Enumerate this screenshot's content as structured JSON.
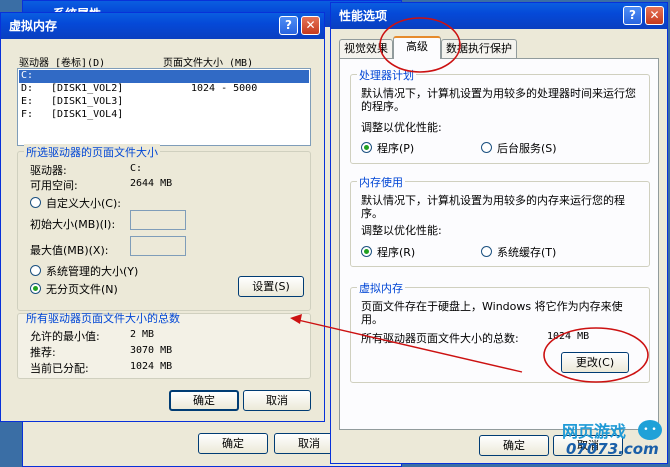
{
  "back_window": {
    "title": "系统属性",
    "ok": "确定",
    "cancel": "取消"
  },
  "virtual_memory_dialog": {
    "title": "虚拟内存",
    "help": "?",
    "close": "✕",
    "columns": {
      "drive": "驱动器 [卷标](D)",
      "size": "页面文件大小 (MB)"
    },
    "drives": [
      {
        "drive": "C:",
        "label": "",
        "size": ""
      },
      {
        "drive": "D:",
        "label": "[DISK1_VOL2]",
        "size": "1024 - 5000"
      },
      {
        "drive": "E:",
        "label": "[DISK1_VOL3]",
        "size": ""
      },
      {
        "drive": "F:",
        "label": "[DISK1_VOL4]",
        "size": ""
      }
    ],
    "selected": {
      "title": "所选驱动器的页面文件大小",
      "drive_label": "驱动器:",
      "drive_value": "C:",
      "space_label": "可用空间:",
      "space_value": "2644 MB",
      "custom_size": "自定义大小(C):",
      "initial_size": "初始大小(MB)(I):",
      "max_size": "最大值(MB)(X):",
      "system_managed": "系统管理的大小(Y)",
      "no_paging": "无分页文件(N)",
      "set_button": "设置(S)"
    },
    "totals": {
      "title": "所有驱动器页面文件大小的总数",
      "min_label": "允许的最小值:",
      "min_value": "2 MB",
      "recommended_label": "推荐:",
      "recommended_value": "3070 MB",
      "current_label": "当前已分配:",
      "current_value": "1024 MB"
    },
    "ok": "确定",
    "cancel": "取消"
  },
  "performance_options": {
    "title": "性能选项",
    "help": "?",
    "close": "✕",
    "tabs": [
      "视觉效果",
      "高级",
      "数据执行保护"
    ],
    "processor": {
      "title": "处理器计划",
      "desc": "默认情况下，计算机设置为用较多的处理器时间来运行您的程序。",
      "adjust": "调整以优化性能:",
      "programs": "程序(P)",
      "background": "后台服务(S)"
    },
    "memory": {
      "title": "内存使用",
      "desc": "默认情况下，计算机设置为用较多的内存来运行您的程序。",
      "adjust": "调整以优化性能:",
      "programs": "程序(R)",
      "cache": "系统缓存(T)"
    },
    "virtual": {
      "title": "虚拟内存",
      "desc": "页面文件存在于硬盘上，Windows 将它作为内存来使用。",
      "total_label": "所有驱动器页面文件大小的总数:",
      "total_value": "1024 MB",
      "change_button": "更改(C)"
    },
    "ok": "确定",
    "cancel": "取消"
  },
  "watermark": {
    "text": "网页游戏",
    "site": "07073.com"
  },
  "colors": {
    "annotation_red": "#cc1111",
    "title_blue": "#0549d8",
    "group_blue": "#0046d5"
  }
}
